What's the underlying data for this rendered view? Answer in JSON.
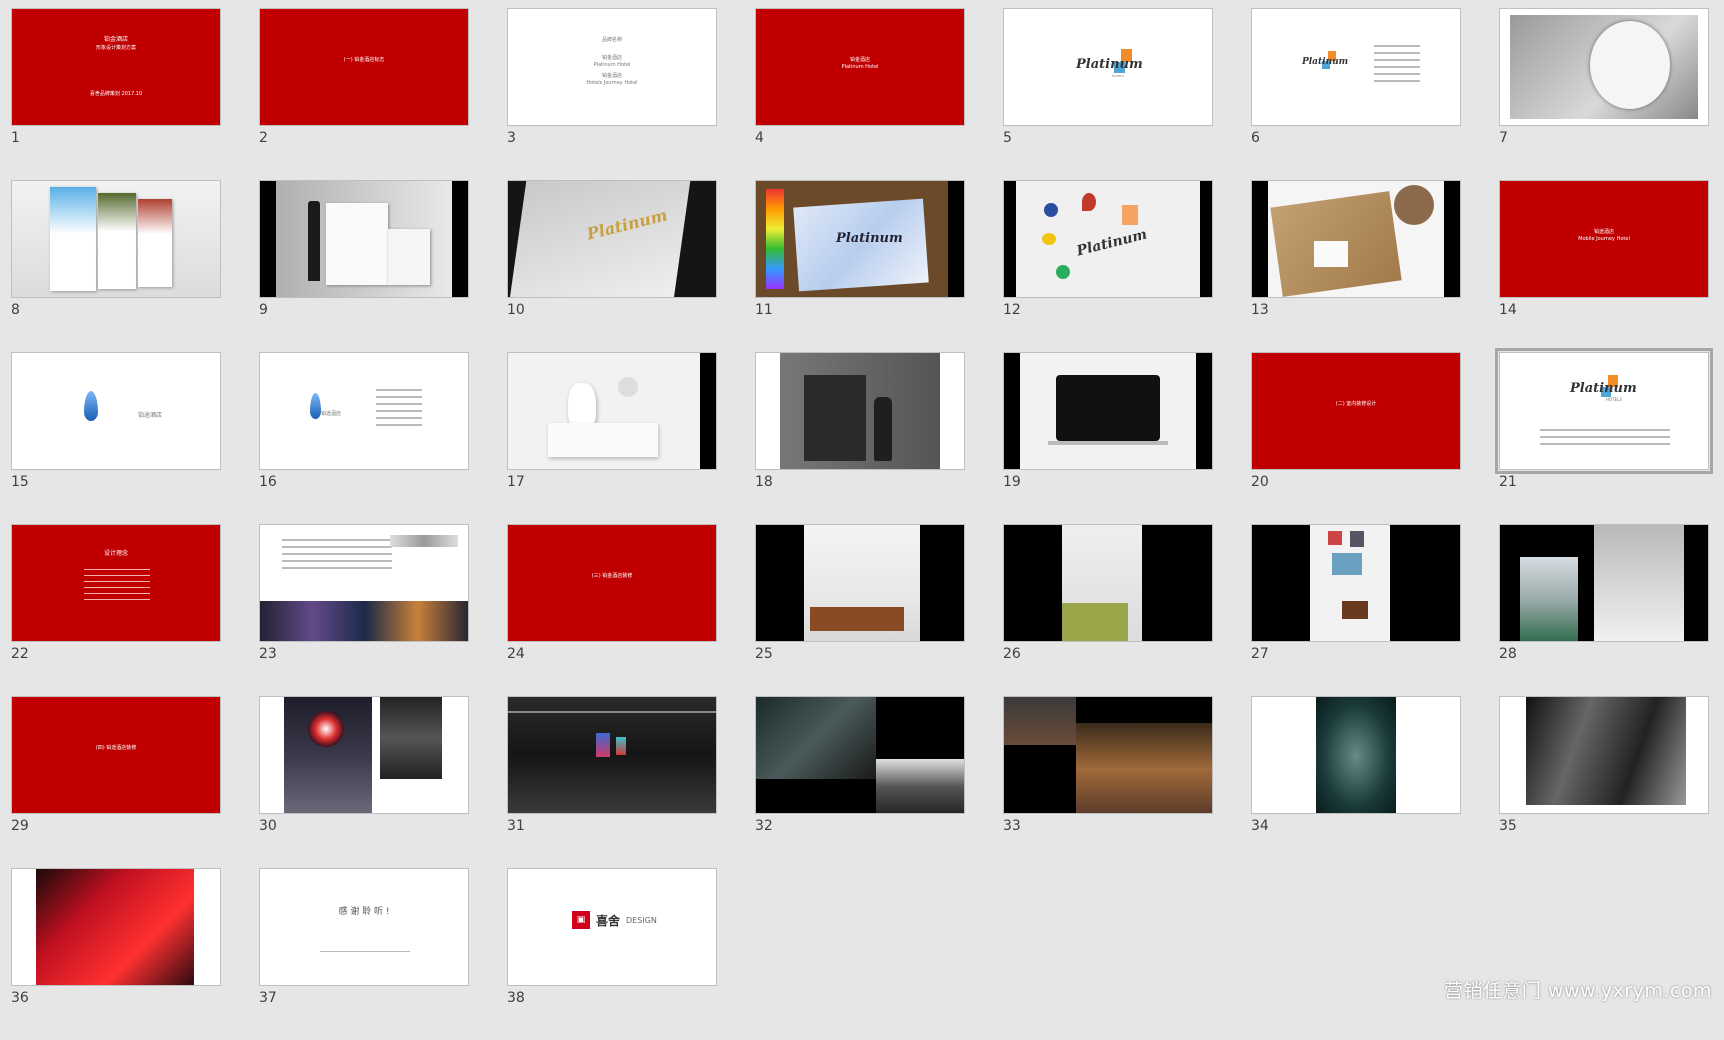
{
  "slides": [
    {
      "n": "1",
      "kind": "red",
      "t1": "铂金酒店",
      "t2": "形象设计策划方案",
      "t3": "喜舍品牌策划 2017.10"
    },
    {
      "n": "2",
      "kind": "red",
      "t1": "(一) 铂金酒店标志"
    },
    {
      "n": "3",
      "kind": "white-text",
      "t1": "品牌名称",
      "t2": "铂金酒店",
      "t3": "Platinum Hotel",
      "t4": "铂金酒店",
      "t5": "Hotels Journey Hotel"
    },
    {
      "n": "4",
      "kind": "red",
      "t1": "铂金酒店",
      "t2": "Platinum Hotel"
    },
    {
      "n": "5",
      "kind": "logo",
      "logo": "Platinum",
      "sub": "HOTELS"
    },
    {
      "n": "6",
      "kind": "logo-text",
      "logo": "Platinum"
    },
    {
      "n": "7",
      "kind": "photo"
    },
    {
      "n": "8",
      "kind": "photo"
    },
    {
      "n": "9",
      "kind": "photo"
    },
    {
      "n": "10",
      "kind": "photo",
      "logo": "Platinum"
    },
    {
      "n": "11",
      "kind": "photo",
      "logo": "Platinum"
    },
    {
      "n": "12",
      "kind": "photo",
      "logo": "Platinum"
    },
    {
      "n": "13",
      "kind": "photo"
    },
    {
      "n": "14",
      "kind": "red",
      "t1": "铂途酒店",
      "t2": "Mobile Journey Hotel"
    },
    {
      "n": "15",
      "kind": "flame",
      "t1": "铂途酒店"
    },
    {
      "n": "16",
      "kind": "flame-text",
      "t1": "铂途酒店"
    },
    {
      "n": "17",
      "kind": "photo"
    },
    {
      "n": "18",
      "kind": "photo"
    },
    {
      "n": "19",
      "kind": "photo"
    },
    {
      "n": "20",
      "kind": "red",
      "t1": "(二) 室内装修设计"
    },
    {
      "n": "21",
      "kind": "logo-para",
      "logo": "Platinum",
      "sub": "HOTELS"
    },
    {
      "n": "22",
      "kind": "red-list",
      "t1": "设计理念"
    },
    {
      "n": "23",
      "kind": "photo"
    },
    {
      "n": "24",
      "kind": "red",
      "t1": "(三) 铂金酒店装修"
    },
    {
      "n": "25",
      "kind": "photo"
    },
    {
      "n": "26",
      "kind": "photo"
    },
    {
      "n": "27",
      "kind": "photo"
    },
    {
      "n": "28",
      "kind": "photo"
    },
    {
      "n": "29",
      "kind": "red",
      "t1": "(四) 铂途酒店装修"
    },
    {
      "n": "30",
      "kind": "photo"
    },
    {
      "n": "31",
      "kind": "photo"
    },
    {
      "n": "32",
      "kind": "photo"
    },
    {
      "n": "33",
      "kind": "photo"
    },
    {
      "n": "34",
      "kind": "photo"
    },
    {
      "n": "35",
      "kind": "photo"
    },
    {
      "n": "36",
      "kind": "photo"
    },
    {
      "n": "37",
      "kind": "thanks",
      "t1": "感 谢 聆 听 !"
    },
    {
      "n": "38",
      "kind": "brand",
      "b1": "喜舍",
      "b2": "DESIGN"
    }
  ],
  "selected_slide": "21",
  "watermark": "营销任意门 www.yxrym.com",
  "colors": {
    "red": "#c00000",
    "background": "#e6e6e6"
  }
}
